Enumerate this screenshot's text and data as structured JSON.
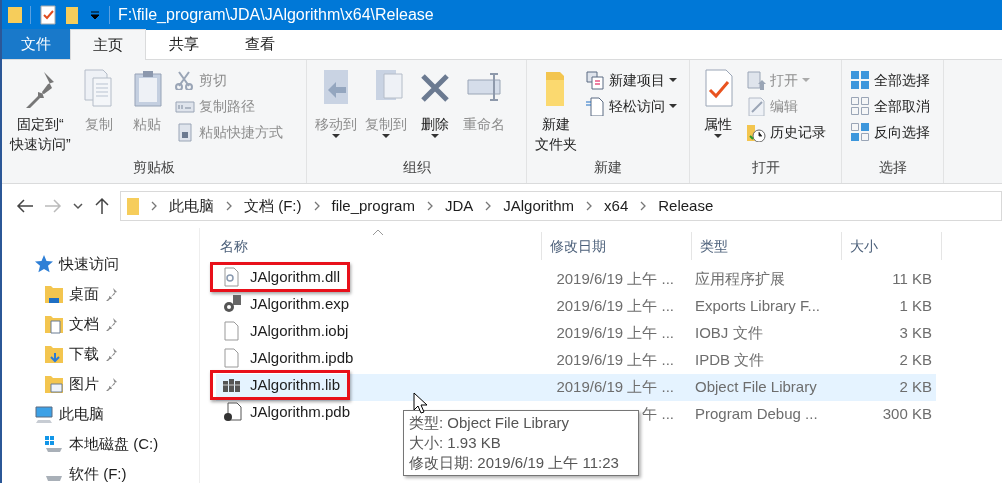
{
  "window": {
    "title": "F:\\file_program\\JDA\\JAlgorithm\\x64\\Release"
  },
  "ribbon_tabs": [
    {
      "label": "文件",
      "kind": "file",
      "selected": false
    },
    {
      "label": "主页",
      "kind": "tab",
      "selected": true
    },
    {
      "label": "共享",
      "kind": "tab",
      "selected": false
    },
    {
      "label": "查看",
      "kind": "tab",
      "selected": false
    }
  ],
  "ribbon_groups": [
    {
      "label": "剪贴板",
      "items": [
        {
          "kind": "large",
          "label": [
            "固定到“",
            "快速访问”"
          ],
          "disabled": false,
          "menu": false
        },
        {
          "kind": "large",
          "label": [
            "复制"
          ],
          "disabled": true,
          "menu": false
        },
        {
          "kind": "large",
          "label": [
            "粘贴"
          ],
          "disabled": true,
          "menu": false
        },
        {
          "kind": "small",
          "label": "剪切",
          "disabled": true,
          "menu": false
        },
        {
          "kind": "small",
          "label": "复制路径",
          "disabled": true,
          "menu": false
        },
        {
          "kind": "small",
          "label": "粘贴快捷方式",
          "disabled": true,
          "menu": false
        }
      ]
    },
    {
      "label": "组织",
      "items": [
        {
          "kind": "large",
          "label": [
            "移动到"
          ],
          "disabled": true,
          "menu": true
        },
        {
          "kind": "large",
          "label": [
            "复制到"
          ],
          "disabled": true,
          "menu": true
        },
        {
          "kind": "large",
          "label": [
            "删除"
          ],
          "disabled": false,
          "menu": true
        },
        {
          "kind": "large",
          "label": [
            "重命名"
          ],
          "disabled": true,
          "menu": false
        }
      ]
    },
    {
      "label": "新建",
      "items": [
        {
          "kind": "large",
          "label": [
            "新建",
            "文件夹"
          ],
          "disabled": false,
          "menu": false
        },
        {
          "kind": "small",
          "label": "新建项目",
          "disabled": false,
          "menu": true
        },
        {
          "kind": "small",
          "label": "轻松访问",
          "disabled": false,
          "menu": true
        }
      ]
    },
    {
      "label": "打开",
      "items": [
        {
          "kind": "large",
          "label": [
            "属性"
          ],
          "disabled": false,
          "menu": true
        },
        {
          "kind": "small",
          "label": "打开",
          "disabled": true,
          "menu": true
        },
        {
          "kind": "small",
          "label": "编辑",
          "disabled": true,
          "menu": false
        },
        {
          "kind": "small",
          "label": "历史记录",
          "disabled": false,
          "menu": false
        }
      ]
    },
    {
      "label": "选择",
      "items": [
        {
          "kind": "small",
          "label": "全部选择",
          "disabled": false,
          "menu": false
        },
        {
          "kind": "small",
          "label": "全部取消",
          "disabled": false,
          "menu": false
        },
        {
          "kind": "small",
          "label": "反向选择",
          "disabled": false,
          "menu": false
        }
      ]
    }
  ],
  "address_bar": {
    "breadcrumbs": [
      "此电脑",
      "文档 (F:)",
      "file_program",
      "JDA",
      "JAlgorithm",
      "x64",
      "Release"
    ]
  },
  "navigation": [
    {
      "label": "快速访问",
      "kind": "star",
      "children": [
        {
          "label": "桌面",
          "pinned": true
        },
        {
          "label": "文档",
          "pinned": true
        },
        {
          "label": "下载",
          "pinned": true
        },
        {
          "label": "图片",
          "pinned": true
        }
      ]
    },
    {
      "label": "此电脑",
      "kind": "pc",
      "children": [
        {
          "label": "本地磁盘 (C:)",
          "pinned": false
        },
        {
          "label": "软件 (F:)",
          "pinned": false
        }
      ]
    }
  ],
  "table": {
    "columns": [
      "名称",
      "修改日期",
      "类型",
      "大小"
    ],
    "rows": [
      {
        "name": "JAlgorithm.dll",
        "date": "2019/6/19 上午 ...",
        "type": "应用程序扩展",
        "size": "11 KB",
        "selected": false,
        "annotated": true
      },
      {
        "name": "JAlgorithm.exp",
        "date": "2019/6/19 上午 ...",
        "type": "Exports Library F...",
        "size": "1 KB",
        "selected": false,
        "annotated": false
      },
      {
        "name": "JAlgorithm.iobj",
        "date": "2019/6/19 上午 ...",
        "type": "IOBJ 文件",
        "size": "3 KB",
        "selected": false,
        "annotated": false
      },
      {
        "name": "JAlgorithm.ipdb",
        "date": "2019/6/19 上午 ...",
        "type": "IPDB 文件",
        "size": "2 KB",
        "selected": false,
        "annotated": false
      },
      {
        "name": "JAlgorithm.lib",
        "date": "2019/6/19 上午 ...",
        "type": "Object File Library",
        "size": "2 KB",
        "selected": true,
        "annotated": true
      },
      {
        "name": "JAlgorithm.pdb",
        "date": "午 ...",
        "type": "Program Debug ...",
        "size": "300 KB",
        "selected": false,
        "annotated": false
      }
    ]
  },
  "tooltip": {
    "lines": [
      "类型: Object File Library",
      "大小: 1.93 KB",
      "修改日期: 2019/6/19 上午 11:23"
    ]
  }
}
